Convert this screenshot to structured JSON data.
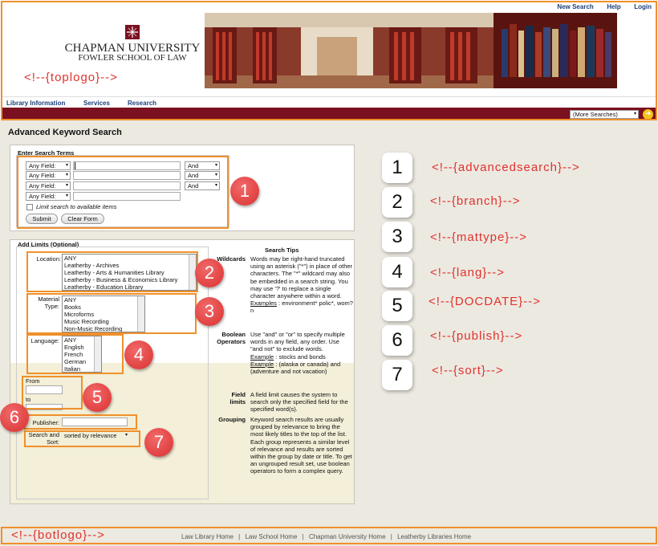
{
  "header": {
    "top_links": [
      "New Search",
      "Help",
      "Login"
    ],
    "university": "CHAPMAN UNIVERSITY",
    "school": "FOWLER SCHOOL OF LAW",
    "toplogo_tag": "<!--{toplogo}-->",
    "nav": [
      "Library Information",
      "Services",
      "Research"
    ],
    "more_searches": "(More Searches)"
  },
  "page_title": "Advanced Keyword Search",
  "search_terms": {
    "legend": "Enter Search Terms",
    "field_label": "Any Field:",
    "operator": "And",
    "limit_label": "Limit search to available items",
    "submit": "Submit",
    "clear": "Clear Form"
  },
  "limits": {
    "legend": "Add Limits (Optional)",
    "location_label": "Location:",
    "locations": [
      "ANY",
      "Leatherby - Archives",
      "Leatherby - Arts & Humanities Library",
      "Leatherby - Business & Economics Library",
      "Leatherby - Education Library"
    ],
    "material_label": "Material Type:",
    "materials": [
      "ANY",
      "Books",
      "Microforms",
      "Music Recording",
      "Non-Music Recording"
    ],
    "language_label": "Language:",
    "languages": [
      "ANY",
      "English",
      "French",
      "German",
      "Italian"
    ],
    "from_label": "From",
    "to_label": "to",
    "publisher_label": "Publisher:",
    "sort_label": "Search and Sort:",
    "sort_value": "sorted by relevance"
  },
  "tips": {
    "title": "Search Tips",
    "wildcards_term": "Wildcards",
    "wildcards_text": "Words may be right-hand truncated using an asterisk (\"*\") in place of other characters. The \"*\" wildcard may also be embedded in a search string. You may use '?' to replace a single character anywhere within a word.",
    "wildcards_example_label": "Examples",
    "wildcards_example": " : environment* polic*, wom?n",
    "boolean_term": "Boolean Operators",
    "boolean_text": "Use \"and\" or \"or\" to specify multiple words in any field, any order. Use \"and not\" to exclude words.",
    "boolean_ex1_label": "Example",
    "boolean_ex1": " : stocks and bonds",
    "boolean_ex2_label": "Example",
    "boolean_ex2": " : (alaska or canada) and (adventure and not vacation)",
    "field_term": "Field limits",
    "field_text": "A field limit causes the system to search only the specified field for the specified word(s).",
    "grouping_term": "Grouping",
    "grouping_text": "Keyword search results are usually grouped by relevance to bring the most likely titles to the top of the list. Each group represents a similar level of relevance and results are sorted within the group by date or title. To get an ungrouped result set, use boolean operators to form a complex query."
  },
  "callouts": [
    "1",
    "2",
    "3",
    "4",
    "5",
    "6",
    "7"
  ],
  "legend": [
    {
      "num": "1",
      "tag": "<!--{advancedsearch}-->"
    },
    {
      "num": "2",
      "tag": "<!--{branch}-->"
    },
    {
      "num": "3",
      "tag": "<!--{mattype}-->"
    },
    {
      "num": "4",
      "tag": "<!--{lang}-->"
    },
    {
      "num": "5",
      "tag": "<!--{DOCDATE}-->"
    },
    {
      "num": "6",
      "tag": "<!--{publish}-->"
    },
    {
      "num": "7",
      "tag": "<!--{sort}-->"
    }
  ],
  "footer": {
    "botlogo_tag": "<!--{botlogo}-->",
    "links": [
      "Law Library Home",
      "Law School Home",
      "Chapman University Home",
      "Leatherby Libraries Home"
    ],
    "separator": "|"
  },
  "colors": {
    "maroon": "#7b1020",
    "orange": "#f0902a",
    "callout_red": "#d93030",
    "legend_red": "#e0322c",
    "link_blue": "#1c3f7a"
  }
}
